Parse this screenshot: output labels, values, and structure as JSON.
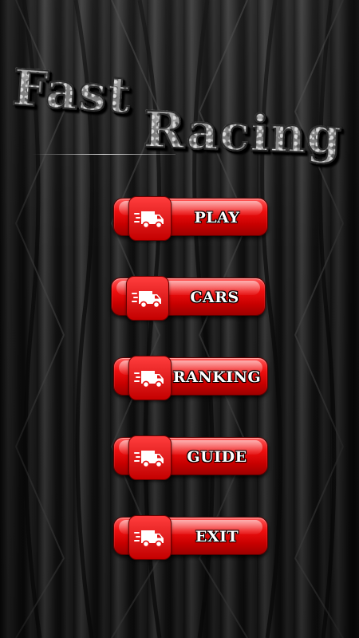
{
  "title": {
    "line1": "Fast",
    "line2": "Racing"
  },
  "menu": {
    "items": [
      {
        "label": "PLAY",
        "icon": "delivery-truck-icon"
      },
      {
        "label": "CARS",
        "icon": "delivery-truck-icon"
      },
      {
        "label": "RANKING",
        "icon": "delivery-truck-icon"
      },
      {
        "label": "GUIDE",
        "icon": "delivery-truck-icon"
      },
      {
        "label": "EXIT",
        "icon": "delivery-truck-icon"
      }
    ]
  },
  "colors": {
    "button_red": "#e01010",
    "tread_dark": "#1a1a1a",
    "label_white": "#ffffff"
  }
}
